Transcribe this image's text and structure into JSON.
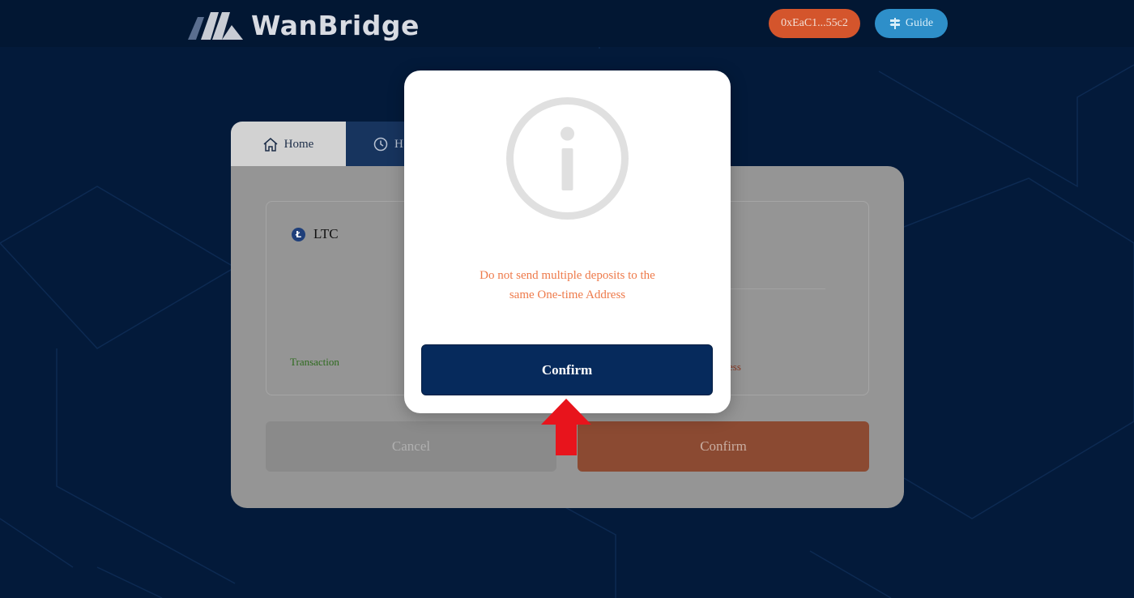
{
  "app": {
    "brand_name": "WanBridge"
  },
  "header": {
    "wallet_address": "0xEaC1...55c2",
    "guide_label": "Guide"
  },
  "tabs": [
    {
      "label": "Home"
    },
    {
      "label": "H"
    }
  ],
  "card": {
    "coin": "LTC",
    "coin_icon_letter": "Ł",
    "transaction_label": "Transaction",
    "address_label_fragment": "ess",
    "cancel_label": "Cancel",
    "confirm_label": "Confirm"
  },
  "modal": {
    "message_line1": "Do not send multiple deposits to the",
    "message_line2": "same One-time Address",
    "confirm_label": "Confirm"
  },
  "colors": {
    "background": "#031a3a",
    "wallet": "#d4552c",
    "guide": "#2e8fc9",
    "modal_confirm": "#062a5c",
    "warning_text": "#ee7a4a",
    "annotation_arrow": "#e8141c"
  },
  "icons": {
    "home": "home-icon",
    "history": "clock-icon",
    "guide": "signpost-icon",
    "info": "info-icon",
    "coin": "litecoin-icon"
  }
}
